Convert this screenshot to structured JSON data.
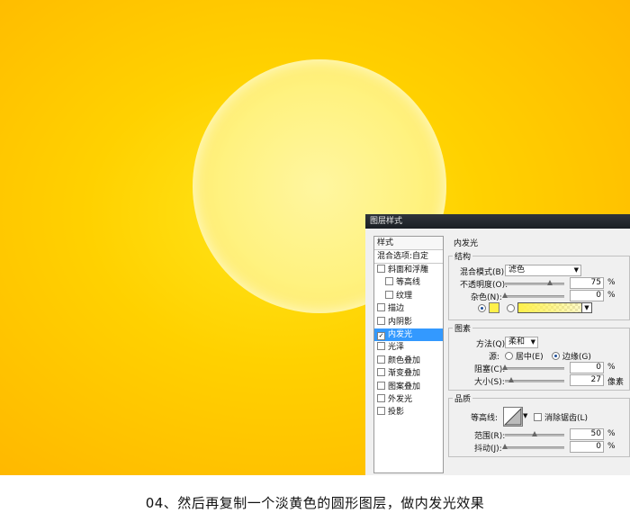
{
  "caption": "04、然后再复制一个淡黄色的圆形图层，做内发光效果",
  "dialog": {
    "title": "图层样式",
    "left": {
      "header": "样式",
      "blend_options": "混合选项:自定",
      "items": [
        {
          "label": "斜面和浮雕",
          "checked": false
        },
        {
          "label": "等高线",
          "checked": false
        },
        {
          "label": "纹理",
          "checked": false
        },
        {
          "label": "描边",
          "checked": false
        },
        {
          "label": "内阴影",
          "checked": false
        },
        {
          "label": "内发光",
          "checked": true
        },
        {
          "label": "光泽",
          "checked": false
        },
        {
          "label": "颜色叠加",
          "checked": false
        },
        {
          "label": "渐变叠加",
          "checked": false
        },
        {
          "label": "图案叠加",
          "checked": false
        },
        {
          "label": "外发光",
          "checked": false
        },
        {
          "label": "投影",
          "checked": false
        }
      ],
      "check_mark": "✓"
    },
    "panel_title": "内发光",
    "structure": {
      "legend": "结构",
      "blend_mode_label": "混合模式(B):",
      "blend_mode_value": "滤色",
      "opacity_label": "不透明度(O):",
      "opacity_value": "75",
      "opacity_fraction": 0.75,
      "noise_label": "杂色(N):",
      "noise_value": "0",
      "percent": "%",
      "glow_color": "#fff04a"
    },
    "elements": {
      "legend": "图素",
      "technique_label": "方法(Q):",
      "technique_value": "柔和",
      "source_label": "源:",
      "source_center": "居中(E)",
      "source_edge": "边缘(G)",
      "choke_label": "阻塞(C):",
      "choke_value": "0",
      "size_label": "大小(S):",
      "size_value": "27",
      "size_unit": "像素",
      "percent": "%"
    },
    "quality": {
      "legend": "品质",
      "contour_label": "等高线:",
      "antialias_label": "消除锯齿(L)",
      "range_label": "范围(R):",
      "range_value": "50",
      "jitter_label": "抖动(J):",
      "jitter_value": "0",
      "percent": "%"
    }
  },
  "colors": {
    "background_center": "#ffe61a",
    "background_edge": "#ffb400",
    "circle_fill": "#fff27f",
    "selection": "#3399ff"
  }
}
